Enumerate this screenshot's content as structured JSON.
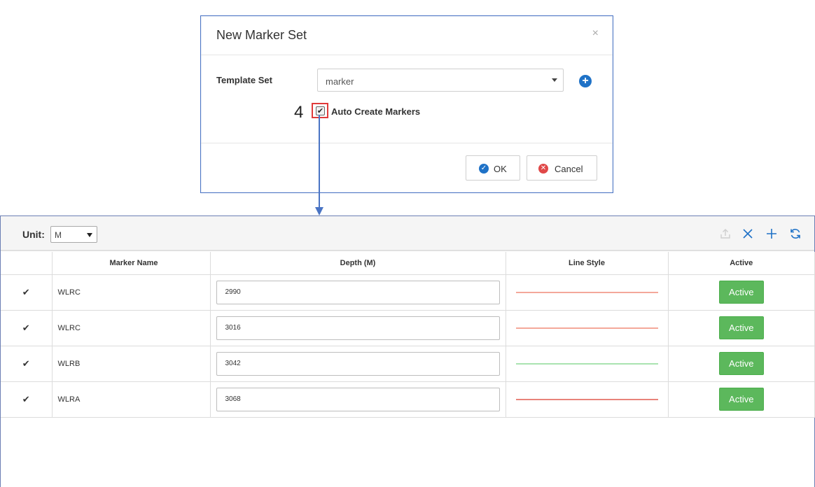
{
  "modal": {
    "title": "New Marker Set",
    "close_glyph": "×",
    "template_set_label": "Template Set",
    "template_set_value": "marker",
    "step_number": "4",
    "auto_create_label": "Auto Create Markers",
    "auto_create_checked": true,
    "ok_label": "OK",
    "cancel_label": "Cancel"
  },
  "toolbar": {
    "unit_label": "Unit:",
    "unit_value": "M",
    "icons": [
      "upload-icon",
      "close-icon",
      "add-icon",
      "refresh-icon"
    ]
  },
  "table": {
    "columns": [
      "",
      "Marker Name",
      "Depth (M)",
      "Line Style",
      "Active"
    ],
    "rows": [
      {
        "name": "WLRC",
        "depth": "2990",
        "line_color": "#f4a89a",
        "active_label": "Active"
      },
      {
        "name": "WLRC",
        "depth": "3016",
        "line_color": "#f4a89a",
        "active_label": "Active"
      },
      {
        "name": "WLRB",
        "depth": "3042",
        "line_color": "#a9e3b0",
        "active_label": "Active"
      },
      {
        "name": "WLRA",
        "depth": "3068",
        "line_color": "#e8837a",
        "active_label": "Active"
      }
    ]
  },
  "colors": {
    "accent_blue": "#1f72c7",
    "active_green": "#5cb85c",
    "cancel_red": "#e04848",
    "annotation_blue": "#4a74c4",
    "highlight_red": "#e03a3a"
  }
}
